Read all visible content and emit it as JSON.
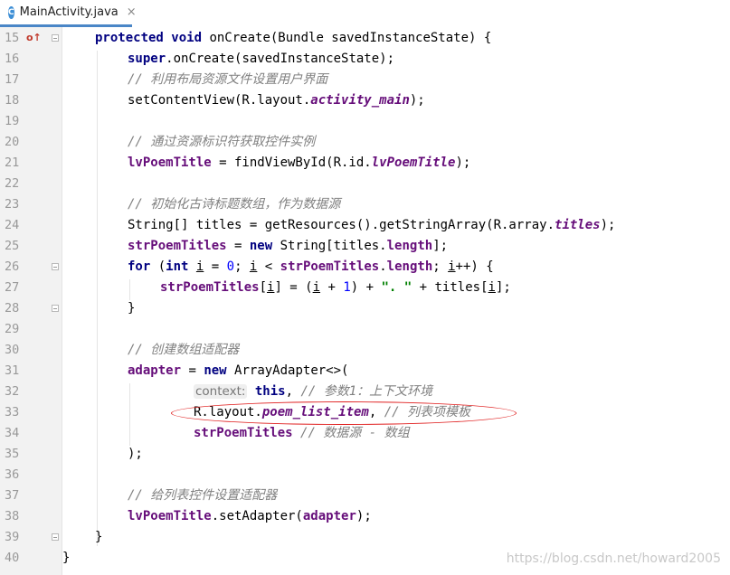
{
  "tab": {
    "icon": "class-file-icon",
    "icon_letter": "C",
    "title": "MainActivity.java",
    "close": "×"
  },
  "lines": [
    {
      "n": "15"
    },
    {
      "n": "16"
    },
    {
      "n": "17"
    },
    {
      "n": "18"
    },
    {
      "n": "19"
    },
    {
      "n": "20"
    },
    {
      "n": "21"
    },
    {
      "n": "22"
    },
    {
      "n": "23"
    },
    {
      "n": "24"
    },
    {
      "n": "25"
    },
    {
      "n": "26"
    },
    {
      "n": "27"
    },
    {
      "n": "28"
    },
    {
      "n": "29"
    },
    {
      "n": "30"
    },
    {
      "n": "31"
    },
    {
      "n": "32"
    },
    {
      "n": "33"
    },
    {
      "n": "34"
    },
    {
      "n": "35"
    },
    {
      "n": "36"
    },
    {
      "n": "37"
    },
    {
      "n": "38"
    },
    {
      "n": "39"
    },
    {
      "n": "40"
    }
  ],
  "code": {
    "l15": {
      "kw1": "protected",
      "kw2": "void",
      "rest": " onCreate(Bundle savedInstanceState) {"
    },
    "l16": {
      "kw": "super",
      "rest": ".onCreate(savedInstanceState);"
    },
    "l17": {
      "cmt": "// 利用布局资源文件设置用户界面"
    },
    "l18": {
      "a": "setContentView(R.layout.",
      "f": "activity_main",
      "b": ");"
    },
    "l20": {
      "cmt": "// 通过资源标识符获取控件实例"
    },
    "l21": {
      "f1": "lvPoemTitle",
      "a": " = findViewById(R.id.",
      "f2": "lvPoemTitle",
      "b": ");"
    },
    "l23": {
      "cmt": "// 初始化古诗标题数组，作为数据源"
    },
    "l24": {
      "a": "String[] titles = getResources().getStringArray(R.array.",
      "f": "titles",
      "b": ");"
    },
    "l25": {
      "f1": "strPoemTitles",
      "a": " = ",
      "kw": "new",
      "b": " String[titles.",
      "f2": "length",
      "c": "];"
    },
    "l26": {
      "kw1": "for",
      "a": " (",
      "kw2": "int",
      "sp": " ",
      "v1": "i",
      "b": " = ",
      "n1": "0",
      "c": "; ",
      "v2": "i",
      "d": " < ",
      "f1": "strPoemTitles",
      "e": ".",
      "f2": "length",
      "g": "; ",
      "v3": "i",
      "h": "++) {"
    },
    "l27": {
      "f": "strPoemTitles",
      "a": "[",
      "v1": "i",
      "b": "] = (",
      "v2": "i",
      "c": " + ",
      "n": "1",
      "d": ") + ",
      "s": "\". \"",
      "e": " + titles[",
      "v3": "i",
      "g": "];"
    },
    "l28": {
      "a": "}"
    },
    "l30": {
      "cmt": "// 创建数组适配器"
    },
    "l31": {
      "f": "adapter",
      "a": " = ",
      "kw": "new",
      "b": " ArrayAdapter<>("
    },
    "l32": {
      "hint": "context:",
      "kw": "this",
      "a": ", ",
      "cmt": "// 参数1：上下文环境"
    },
    "l33": {
      "a": "R.layout.",
      "f": "poem_list_item",
      "b": ", ",
      "cmt": "// 列表项模板"
    },
    "l34": {
      "f": "strPoemTitles",
      "a": " ",
      "cmt": "// 数据源 - 数组"
    },
    "l35": {
      "a": ");"
    },
    "l37": {
      "cmt": "// 给列表控件设置适配器"
    },
    "l38": {
      "f1": "lvPoemTitle",
      "a": ".setAdapter(",
      "f2": "adapter",
      "b": ");"
    },
    "l39": {
      "a": "}"
    },
    "l40": {
      "a": "}"
    }
  },
  "watermark": "https://blog.csdn.net/howard2005",
  "colors": {
    "keyword": "#000080",
    "field": "#660e7a",
    "comment": "#808080",
    "string": "#008000",
    "number": "#0000ff",
    "annotation_ellipse": "#e02020"
  }
}
